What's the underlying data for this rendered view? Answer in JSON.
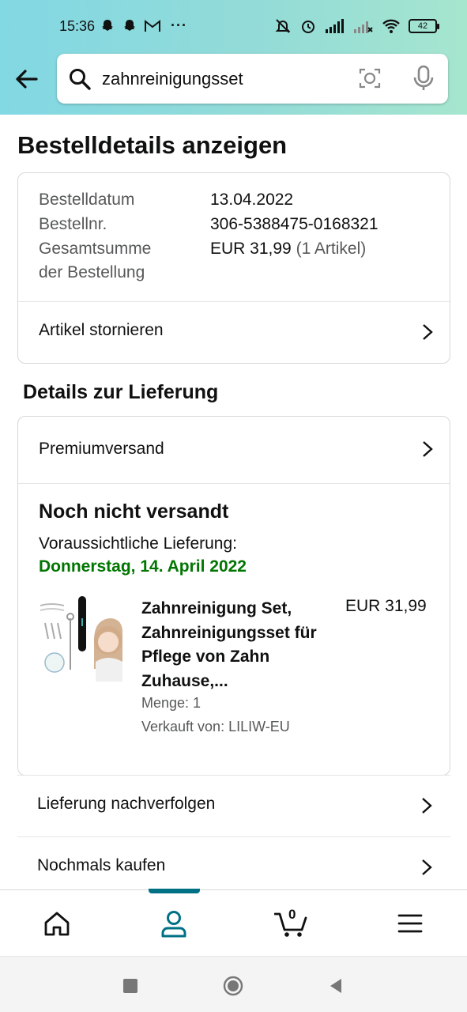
{
  "status_bar": {
    "time": "15:36",
    "battery": "42",
    "more_indicator": "···"
  },
  "search": {
    "value": "zahnreinigungsset",
    "icons": [
      "search-icon",
      "camera-icon",
      "mic-icon"
    ]
  },
  "page": {
    "title": "Bestelldetails anzeigen"
  },
  "summary": {
    "date_label": "Bestelldatum",
    "date_value": "13.04.2022",
    "order_no_label": "Bestellnr.",
    "order_no_value": "306-5388475-0168321",
    "total_label_line1": "Gesamtsumme",
    "total_label_line2": "der Bestellung",
    "total_value": "EUR 31,99",
    "total_items": "(1 Artikel)",
    "cancel_label": "Artikel stornieren"
  },
  "delivery": {
    "section_title": "Details zur Lieferung",
    "shipping_method": "Premiumversand",
    "status": "Noch nicht versandt",
    "eta_label": "Voraussichtliche Lieferung:",
    "eta_date": "Donnerstag, 14. April 2022",
    "product": {
      "title": "Zahnreinigung Set, Zahnreinigungsset für Pflege von Zahn Zuhause,...",
      "price": "EUR 31,99",
      "quantity": "Menge: 1",
      "seller": "Verkauft von: LILIW-EU"
    }
  },
  "actions": {
    "track": "Lieferung nachverfolgen",
    "buy_again": "Nochmals kaufen"
  },
  "bottom_nav": {
    "active": "account",
    "cart_count": "0",
    "items": [
      "home-icon",
      "account-icon",
      "cart-icon",
      "menu-icon"
    ]
  },
  "colors": {
    "accent": "#007185",
    "green": "#007600",
    "header_start": "#82d8e3",
    "header_end": "#a6e6cf"
  }
}
